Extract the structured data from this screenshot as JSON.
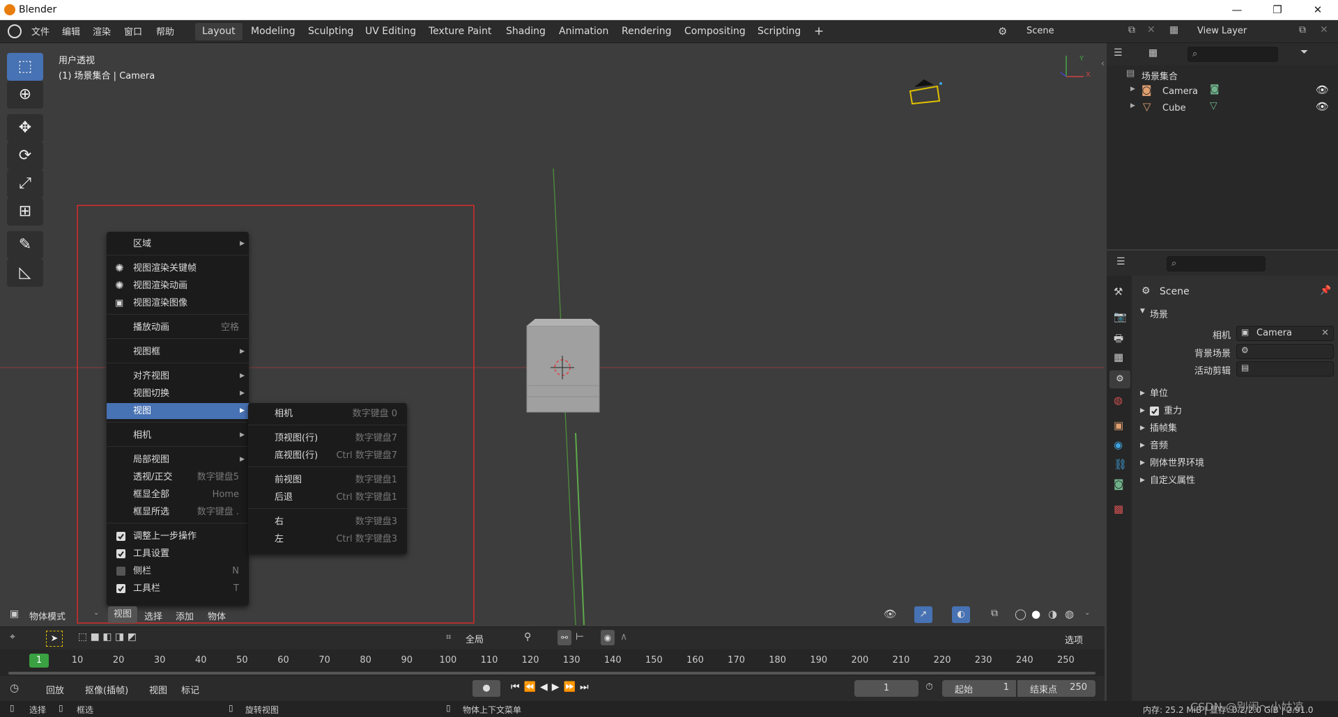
{
  "app": {
    "title": "Blender"
  },
  "window_controls": {
    "minimize": "—",
    "maximize": "❐",
    "close": "✕"
  },
  "topbar": {
    "menus": [
      "文件",
      "编辑",
      "渲染",
      "窗口",
      "帮助"
    ],
    "workspaces": [
      "Layout",
      "Modeling",
      "Sculpting",
      "UV Editing",
      "Texture Paint",
      "Shading",
      "Animation",
      "Rendering",
      "Compositing",
      "Scripting"
    ],
    "active_workspace": "Layout",
    "add_tab": "+",
    "scene": "Scene",
    "view_layer": "View Layer"
  },
  "viewport": {
    "overlay_title": "用户透视",
    "overlay_subtitle": "(1) 场景集合 | Camera",
    "axis_y": "Y",
    "axis_x": "X"
  },
  "context_menu": {
    "items": [
      {
        "label": "区域",
        "sub": true
      },
      {
        "sep": true
      },
      {
        "label": "视图渲染关键帧",
        "icon": "render-icon"
      },
      {
        "label": "视图渲染动画",
        "icon": "render-icon"
      },
      {
        "label": "视图渲染图像",
        "icon": "image-icon"
      },
      {
        "sep": true
      },
      {
        "label": "播放动画",
        "shortcut": "空格"
      },
      {
        "sep": true
      },
      {
        "label": "视图框",
        "sub": true
      },
      {
        "sep": true
      },
      {
        "label": "对齐视图",
        "sub": true
      },
      {
        "label": "视图切换",
        "sub": true
      },
      {
        "label": "视图",
        "sub": true,
        "highlight": true
      },
      {
        "sep": true
      },
      {
        "label": "相机",
        "sub": true
      },
      {
        "sep": true
      },
      {
        "label": "局部视图",
        "sub": true
      },
      {
        "label": "透视/正交",
        "shortcut": "数字键盘5"
      },
      {
        "label": "框显全部",
        "shortcut": "Home"
      },
      {
        "label": "框显所选",
        "shortcut": "数字键盘 ."
      },
      {
        "sep": true
      },
      {
        "label": "调整上一步操作",
        "check": true
      },
      {
        "label": "工具设置",
        "check": true
      },
      {
        "label": "侧栏",
        "check": false,
        "shortcut": "N"
      },
      {
        "label": "工具栏",
        "check": true,
        "shortcut": "T"
      }
    ]
  },
  "view_submenu": {
    "items": [
      {
        "label": "相机",
        "shortcut": "数字键盘 0"
      },
      {
        "sep": true
      },
      {
        "label": "顶视图(行)",
        "shortcut": "数字键盘7"
      },
      {
        "label": "底视图(行)",
        "shortcut": "Ctrl 数字键盘7"
      },
      {
        "sep": true
      },
      {
        "label": "前视图",
        "shortcut": "数字键盘1"
      },
      {
        "label": "后退",
        "shortcut": "Ctrl 数字键盘1"
      },
      {
        "sep": true
      },
      {
        "label": "右",
        "shortcut": "数字键盘3"
      },
      {
        "label": "左",
        "shortcut": "Ctrl 数字键盘3"
      }
    ]
  },
  "viewport_header": {
    "mode": "物体模式",
    "menus": [
      "视图",
      "选择",
      "添加",
      "物体"
    ]
  },
  "timeline_header": {
    "global_label": "全局",
    "options_label": "选项"
  },
  "timeline": {
    "current_frame": "1",
    "ticks": [
      "10",
      "20",
      "30",
      "40",
      "50",
      "60",
      "70",
      "80",
      "90",
      "100",
      "110",
      "120",
      "130",
      "140",
      "150",
      "160",
      "170",
      "180",
      "190",
      "200",
      "210",
      "220",
      "230",
      "240",
      "250"
    ]
  },
  "playback": {
    "menus": [
      "回放",
      "抠像(插帧)",
      "视图",
      "标记"
    ],
    "frame_value": "1",
    "start_label": "起始",
    "start_value": "1",
    "end_label": "结束点",
    "end_value": "250"
  },
  "statusbar": {
    "select": "选择",
    "box_select": "框选",
    "rotate_view": "旋转视图",
    "context_menu": "物体上下文菜单",
    "memory": "内存: 25.2 MiB | 显存: 0.2/2.0 GiB | 2.91.0",
    "watermark": "CSDN @别闹～小姑凉"
  },
  "outliner": {
    "root": "场景集合",
    "items": [
      {
        "label": "Camera"
      },
      {
        "label": "Cube"
      }
    ]
  },
  "properties": {
    "header": "Scene",
    "section_scene": "场景",
    "camera_label": "相机",
    "camera_value": "Camera",
    "bg_scene_label": "背景场景",
    "active_clip_label": "活动剪辑",
    "panels": [
      {
        "label": "单位"
      },
      {
        "label": "重力",
        "check": true
      },
      {
        "label": "插帧集"
      },
      {
        "label": "音频"
      },
      {
        "label": "刚体世界环境"
      },
      {
        "label": "自定义属性"
      }
    ]
  },
  "colors": {
    "accent": "#4772b3",
    "bg_viewport": "#3d3d3d",
    "menu_bg": "#1b1b1b",
    "selection_box": "#d62b2b",
    "current_frame": "#3aa142",
    "camera_gizmo": "#e0c000"
  }
}
